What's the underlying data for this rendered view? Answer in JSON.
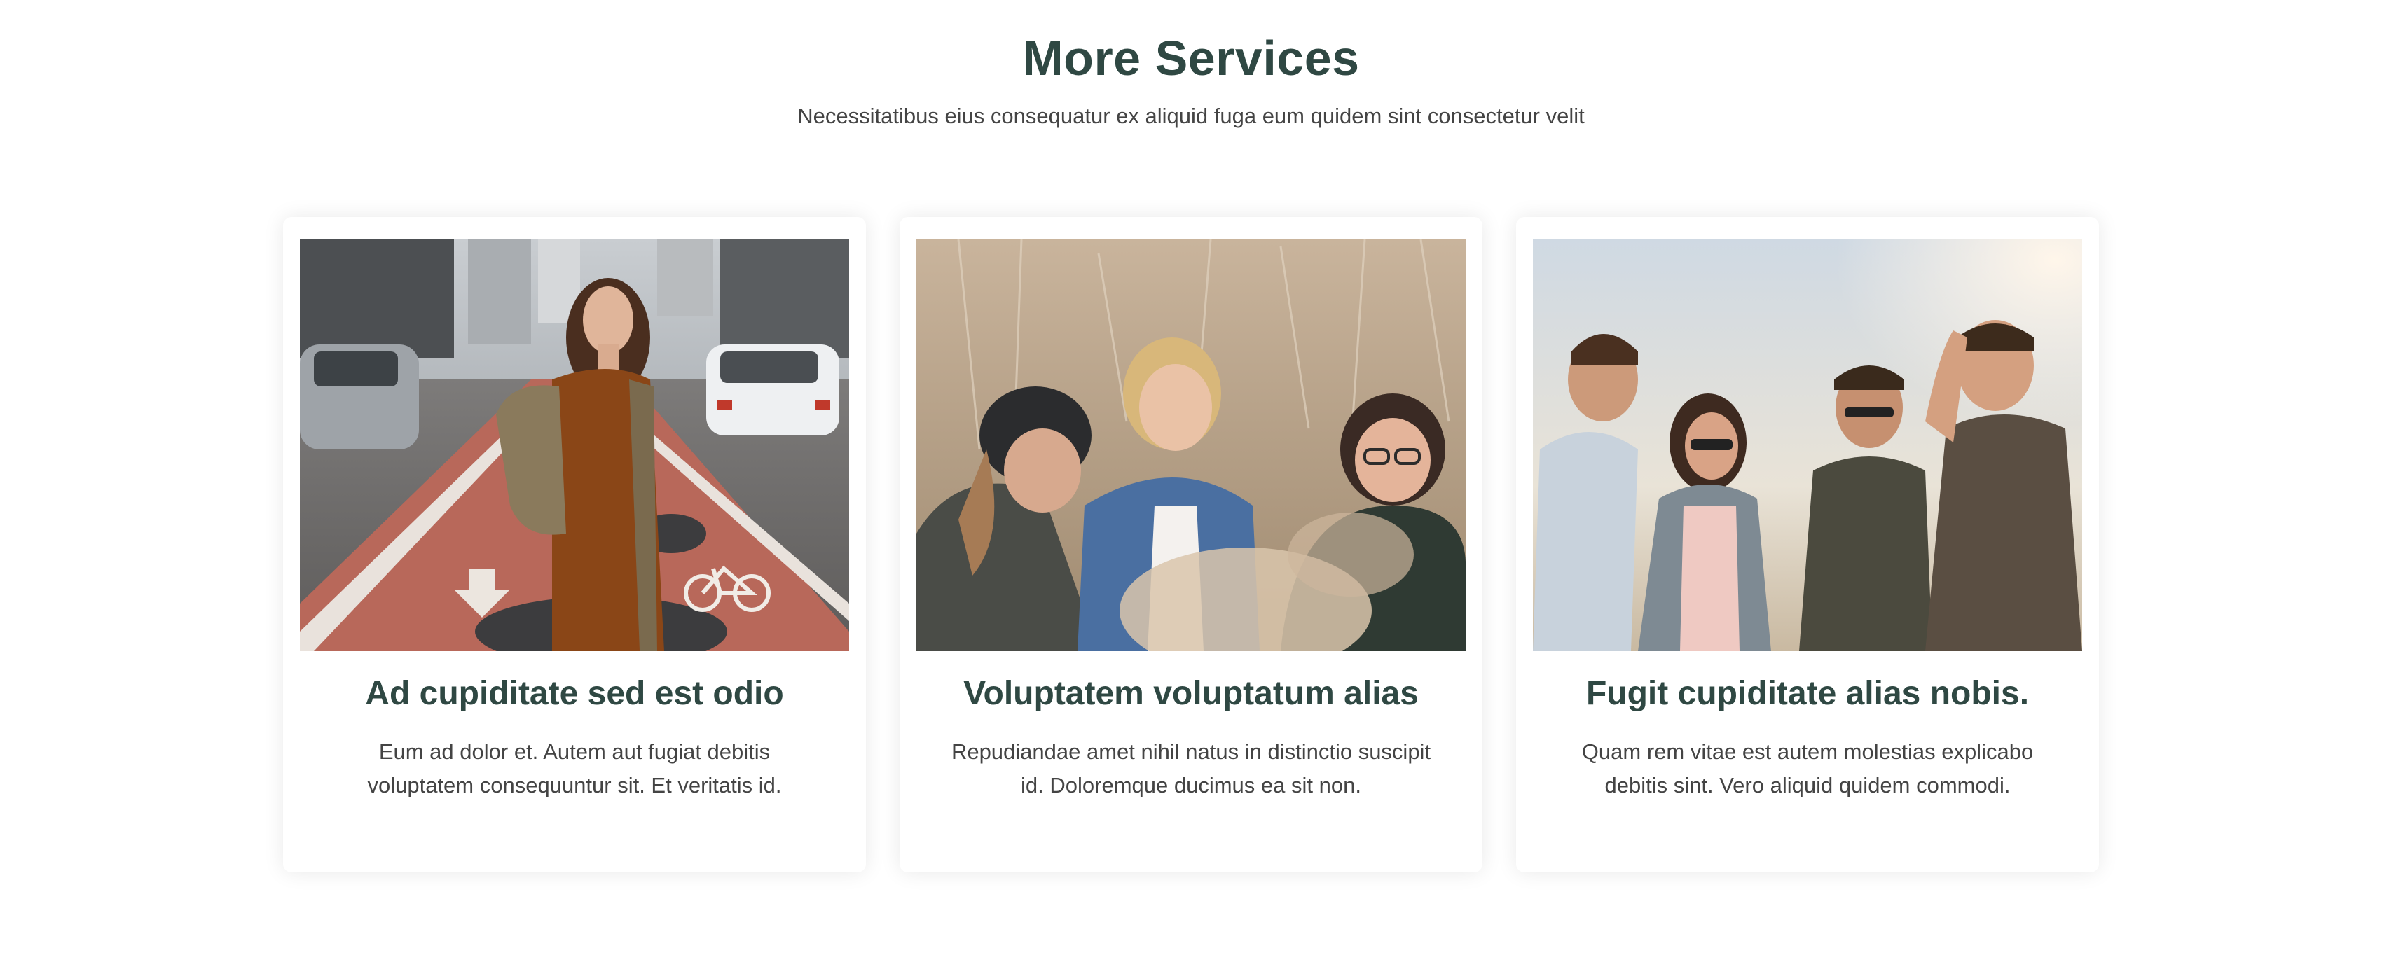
{
  "section": {
    "title": "More Services",
    "subtitle": "Necessitatibus eius consequatur ex aliquid fuga eum quidem sint consectetur velit"
  },
  "cards": [
    {
      "title": "Ad cupiditate sed est odio",
      "text": "Eum ad dolor et. Autem aut fugiat debitis voluptatem consequuntur sit. Et veritatis id."
    },
    {
      "title": "Voluptatem voluptatum alias",
      "text": "Repudiandae amet nihil natus in distinctio suscipit id. Doloremque ducimus ea sit non."
    },
    {
      "title": "Fugit cupiditate alias nobis.",
      "text": "Quam rem vitae est autem molestias explicabo debitis sint. Vero aliquid quidem commodi."
    }
  ],
  "colors": {
    "heading": "#2f4843",
    "body_text": "#444444",
    "background": "#ffffff"
  }
}
